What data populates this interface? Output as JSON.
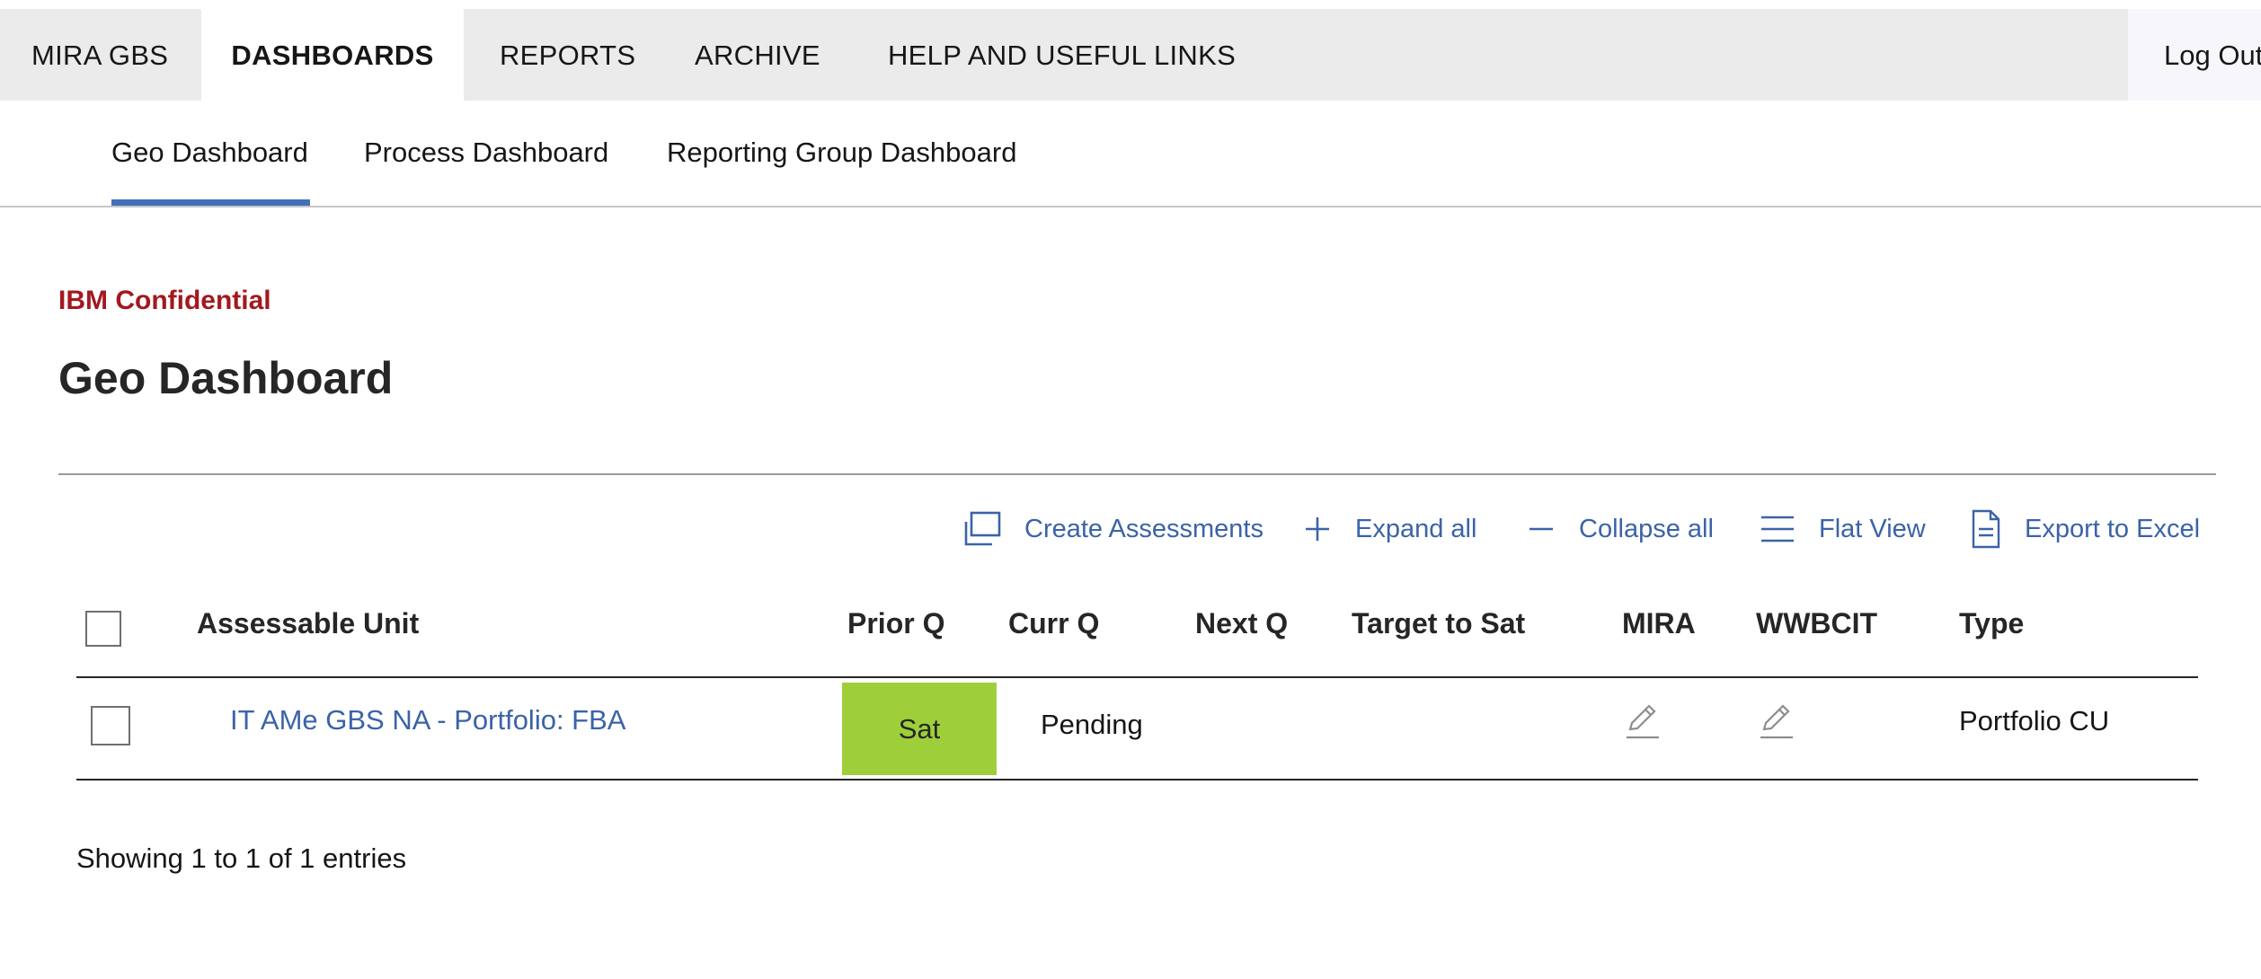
{
  "topnav": {
    "tabs": [
      {
        "label": "MIRA GBS"
      },
      {
        "label": "DASHBOARDS"
      },
      {
        "label": "REPORTS"
      },
      {
        "label": "ARCHIVE"
      },
      {
        "label": "HELP AND USEFUL LINKS"
      }
    ],
    "active_tab": "DASHBOARDS",
    "logout_label": "Log Out"
  },
  "subnav": {
    "tabs": [
      {
        "label": "Geo Dashboard"
      },
      {
        "label": "Process Dashboard"
      },
      {
        "label": "Reporting Group Dashboard"
      }
    ],
    "active_tab": "Geo Dashboard"
  },
  "page": {
    "confidential": "IBM Confidential",
    "title": "Geo Dashboard"
  },
  "toolbar": {
    "create_assessments": "Create Assessments",
    "expand_all": "Expand all",
    "collapse_all": "Collapse all",
    "flat_view": "Flat View",
    "export_excel": "Export to Excel"
  },
  "table": {
    "columns": [
      "Assessable Unit",
      "Prior Q",
      "Curr Q",
      "Next Q",
      "Target to Sat",
      "MIRA",
      "WWBCIT",
      "Type"
    ],
    "rows": [
      {
        "assessable_unit": "IT AMe GBS NA - Portfolio: FBA",
        "prior_q": "Sat",
        "curr_q": "Pending",
        "next_q": "",
        "target_to_sat": "",
        "mira": "edit-icon",
        "wwbcit": "edit-icon",
        "type": "Portfolio CU"
      }
    ],
    "footer": "Showing 1 to 1 of 1 entries"
  },
  "colors": {
    "accent_blue": "#4270b8",
    "link_blue": "#3b63a8",
    "confidential_red": "#a2191f",
    "sat_green": "#9ecf3b",
    "nav_bg": "#ebebeb"
  }
}
